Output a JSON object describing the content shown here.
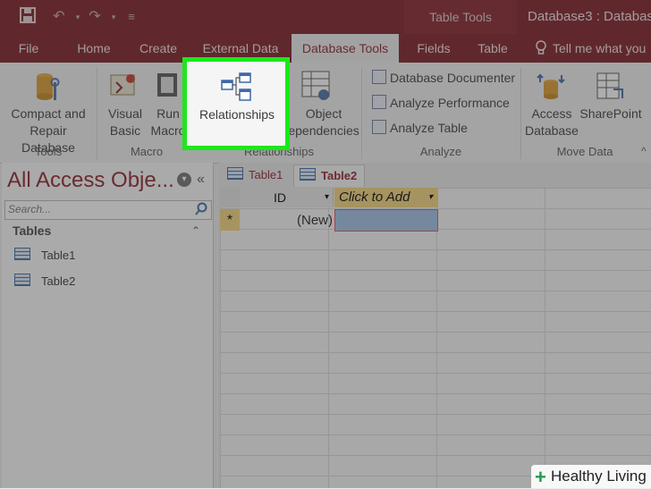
{
  "titlebar": {
    "contextual_tab": "Table Tools",
    "document_title": "Database3 : Database-"
  },
  "tabs": [
    {
      "label": "File"
    },
    {
      "label": "Home"
    },
    {
      "label": "Create"
    },
    {
      "label": "External Data"
    },
    {
      "label": "Database Tools"
    },
    {
      "label": "Fields"
    },
    {
      "label": "Table"
    },
    {
      "label": "Tell me what you"
    }
  ],
  "ribbon": {
    "compact_line1": "Compact and",
    "compact_line2": "Repair Database",
    "visual_line1": "Visual",
    "visual_line2": "Basic",
    "run_line1": "Run",
    "run_line2": "Macro",
    "relationships": "Relationships",
    "object_line1": "Object",
    "object_line2": "Dependencies",
    "db_documenter": "Database Documenter",
    "analyze_performance": "Analyze Performance",
    "analyze_table": "Analyze Table",
    "access_line1": "Access",
    "access_line2": "Database",
    "sharepoint": "SharePoint",
    "groups": {
      "tools": "Tools",
      "macro": "Macro",
      "relationships": "Relationships",
      "analyze": "Analyze",
      "move_data": "Move Data"
    }
  },
  "nav": {
    "title": "All Access Obje...",
    "search_placeholder": "Search...",
    "section": "Tables",
    "items": [
      "Table1",
      "Table2"
    ]
  },
  "doc": {
    "tabs": [
      "Table1",
      "Table2"
    ],
    "columns": [
      "ID",
      "Click to Add"
    ],
    "new_row": "(New)",
    "new_marker": "*"
  },
  "watermark": "Healthy Living",
  "colors": {
    "brand": "#7a1b24",
    "highlight": "#1be81b"
  }
}
